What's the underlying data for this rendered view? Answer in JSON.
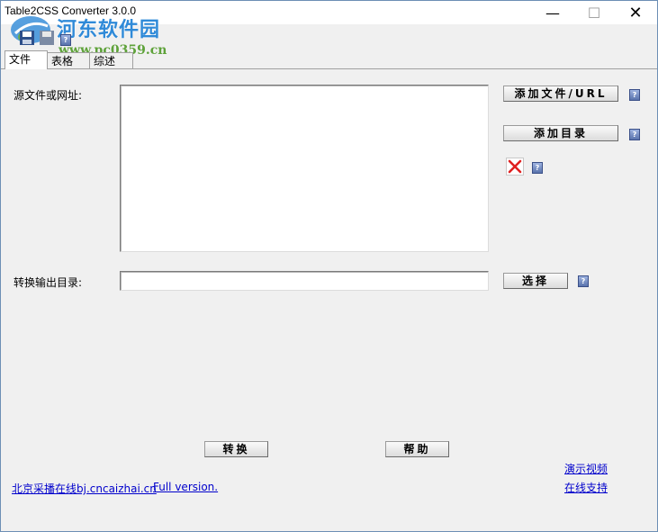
{
  "window": {
    "title": "Table2CSS Converter 3.0.0",
    "controls": {
      "minimize": "—",
      "maximize": "☐",
      "close": "✕"
    }
  },
  "watermark": {
    "name": "河东软件园",
    "url": "www.pc0359.cn"
  },
  "tabs": [
    {
      "label": "文件",
      "active": true
    },
    {
      "label": "表格",
      "active": false
    },
    {
      "label": "综述",
      "active": false
    }
  ],
  "source": {
    "label": "源文件或网址:",
    "value": ""
  },
  "buttons": {
    "add_file": "添加文件/URL",
    "add_dir": "添加目录",
    "choose": "选择",
    "convert": "转换",
    "help": "帮助"
  },
  "output": {
    "label": "转换输出目录:",
    "value": ""
  },
  "footer": {
    "company_link": "北京采播在线bj.cncaizhai.cn",
    "full_version": "Full version.",
    "demo_video": "演示视频",
    "online_support": "在线支持"
  },
  "colors": {
    "link": "#0000cc",
    "help_icon": "#5a73ad",
    "delete": "#e02020"
  }
}
